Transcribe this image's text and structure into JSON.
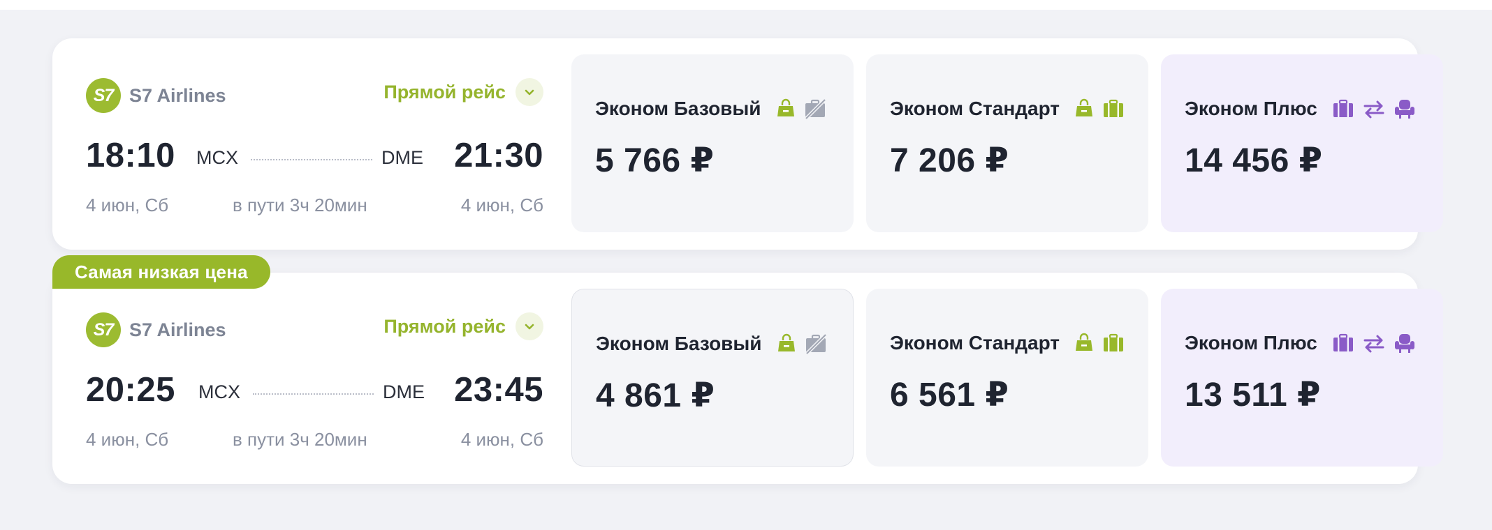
{
  "flights": [
    {
      "airline": "S7 Airlines",
      "logo_text": "S7",
      "direct_label": "Прямой рейс",
      "dep_time": "18:10",
      "arr_time": "21:30",
      "from_code": "MCX",
      "to_code": "DME",
      "dep_date": "4 июн, Сб",
      "arr_date": "4 июн, Сб",
      "duration": "в пути 3ч 20мин",
      "fares": [
        {
          "name": "Эконом Базовый",
          "price": "5 766 ₽",
          "icons": [
            "hand-bag-icon",
            "no-luggage-icon"
          ]
        },
        {
          "name": "Эконом Стандарт",
          "price": "7 206 ₽",
          "icons": [
            "hand-bag-icon",
            "luggage-icon"
          ]
        },
        {
          "name": "Эконом Плюс",
          "price": "14 456 ₽",
          "icons": [
            "luggage-icon",
            "exchange-icon",
            "seat-icon"
          ]
        }
      ]
    },
    {
      "badge": "Самая низкая цена",
      "airline": "S7 Airlines",
      "logo_text": "S7",
      "direct_label": "Прямой рейс",
      "dep_time": "20:25",
      "arr_time": "23:45",
      "from_code": "MCX",
      "to_code": "DME",
      "dep_date": "4 июн, Сб",
      "arr_date": "4 июн, Сб",
      "duration": "в пути 3ч 20мин",
      "fares": [
        {
          "name": "Эконом Базовый",
          "price": "4 861 ₽",
          "icons": [
            "hand-bag-icon",
            "no-luggage-icon"
          ]
        },
        {
          "name": "Эконом Стандарт",
          "price": "6 561 ₽",
          "icons": [
            "hand-bag-icon",
            "luggage-icon"
          ]
        },
        {
          "name": "Эконом Плюс",
          "price": "13 511 ₽",
          "icons": [
            "luggage-icon",
            "exchange-icon",
            "seat-icon"
          ]
        }
      ]
    }
  ],
  "colors": {
    "brand_green": "#98b82a",
    "plus_purple": "#8a5bc7",
    "muted_icon": "#a3a8b5",
    "plus_bg": "#f2eefc",
    "fare_bg": "#f4f5f8"
  }
}
